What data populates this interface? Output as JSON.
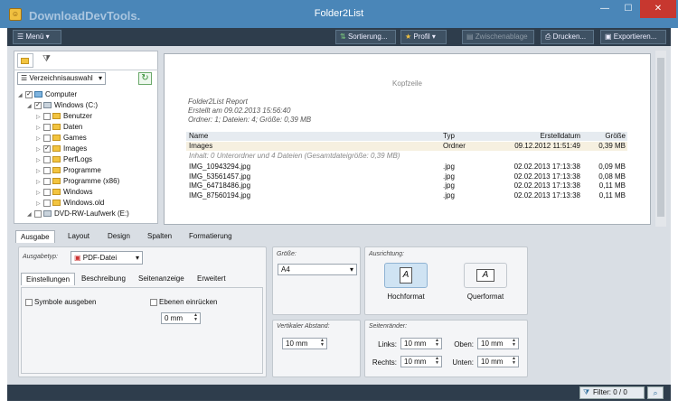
{
  "window": {
    "title": "Folder2List",
    "watermark": "DownloadDevTools.",
    "caption_buttons": [
      "minimize",
      "maximize",
      "close"
    ]
  },
  "toolbar": {
    "menu_label": "Menü",
    "sort_label": "Sortierung...",
    "profile_label": "Profil",
    "clipboard_label": "Zwischenablage",
    "print_label": "Drucken...",
    "export_label": "Exportieren..."
  },
  "left_panel": {
    "dropdown_label": "Verzeichnisauswahl",
    "tree": [
      {
        "label": "Computer",
        "checked": true,
        "indent": 0
      },
      {
        "label": "Windows (C:)",
        "checked": true,
        "indent": 1
      },
      {
        "label": "Benutzer",
        "checked": false,
        "indent": 2
      },
      {
        "label": "Daten",
        "checked": false,
        "indent": 2
      },
      {
        "label": "Games",
        "checked": false,
        "indent": 2
      },
      {
        "label": "Images",
        "checked": true,
        "indent": 2
      },
      {
        "label": "PerfLogs",
        "checked": false,
        "indent": 2
      },
      {
        "label": "Programme",
        "checked": false,
        "indent": 2
      },
      {
        "label": "Programme (x86)",
        "checked": false,
        "indent": 2
      },
      {
        "label": "Windows",
        "checked": false,
        "indent": 2
      },
      {
        "label": "Windows.old",
        "checked": false,
        "indent": 2
      },
      {
        "label": "DVD-RW-Laufwerk (E:)",
        "checked": false,
        "indent": 1
      }
    ]
  },
  "preview": {
    "header": "Kopfzeile",
    "report_title": "Folder2List Report",
    "created": "Erstellt am 09.02.2013 15:56:40",
    "summary": "Ordner: 1;  Dateien: 4;  Größe: 0,39 MB",
    "columns": {
      "name": "Name",
      "type": "Typ",
      "date": "Erstelldatum",
      "size": "Größe"
    },
    "folder_row": {
      "name": "Images",
      "type": "Ordner",
      "date": "09.12.2012 11:51:49",
      "size": "0,39 MB"
    },
    "folder_info": "Inhalt: 0 Unterordner und 4 Dateien (Gesamtdateigröße: 0,39 MB)",
    "files": [
      {
        "name": "IMG_10943294.jpg",
        "type": ".jpg",
        "date": "02.02.2013 17:13:38",
        "size": "0,09 MB"
      },
      {
        "name": "IMG_53561457.jpg",
        "type": ".jpg",
        "date": "02.02.2013 17:13:38",
        "size": "0,08 MB"
      },
      {
        "name": "IMG_64718486.jpg",
        "type": ".jpg",
        "date": "02.02.2013 17:13:38",
        "size": "0,11 MB"
      },
      {
        "name": "IMG_87560194.jpg",
        "type": ".jpg",
        "date": "02.02.2013 17:13:38",
        "size": "0,11 MB"
      }
    ]
  },
  "tabs": [
    "Ausgabe",
    "Layout",
    "Design",
    "Spalten",
    "Formatierung"
  ],
  "output": {
    "type_label": "Ausgabetyp:",
    "type_value": "PDF-Datei",
    "subtabs": [
      "Einstellungen",
      "Beschreibung",
      "Seitenanzeige",
      "Erweitert"
    ],
    "symbols_label": "Symbole ausgeben",
    "indent_label": "Ebenen einrücken",
    "indent_value": "0 mm"
  },
  "size_group": {
    "label": "Größe:",
    "value": "A4"
  },
  "vspace_group": {
    "label": "Vertikaler Abstand:",
    "value": "10 mm"
  },
  "orientation": {
    "label": "Ausrichtung:",
    "portrait": "Hochformat",
    "landscape": "Querformat",
    "glyph": "A"
  },
  "margins": {
    "label": "Seitenränder:",
    "left_label": "Links:",
    "left_value": "10 mm",
    "top_label": "Oben:",
    "top_value": "10 mm",
    "right_label": "Rechts:",
    "right_value": "10 mm",
    "bottom_label": "Unten:",
    "bottom_value": "10 mm"
  },
  "status": {
    "filter_label": "Filter: 0 / 0"
  }
}
